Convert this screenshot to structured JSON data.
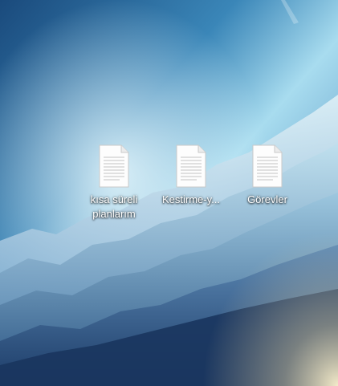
{
  "desktop": {
    "wallpaper_colors": {
      "sky_top": "#1c4e80",
      "sky_glow": "#9fd8f0",
      "mountain_light": "#cfe8f2",
      "mountain_mid": "#5a8cb8",
      "mountain_dark": "#1d3e6c",
      "sun_glow": "#f3e7c4"
    },
    "icons": [
      {
        "label": "kısa süreli planlarım",
        "icon": "text-document-icon"
      },
      {
        "label": "Kestirme-y...",
        "icon": "text-document-icon"
      },
      {
        "label": "Görevler",
        "icon": "text-document-icon"
      }
    ]
  }
}
